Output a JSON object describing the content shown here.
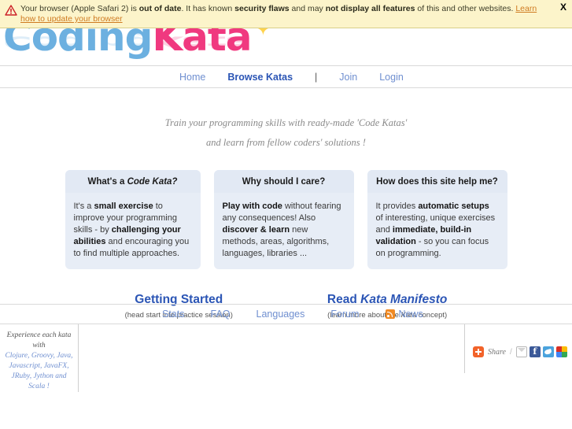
{
  "banner": {
    "warn_icon": "warning-triangle-icon",
    "text_1": "Your browser (Apple Safari 2) is ",
    "bold_1": "out of date",
    "text_2": ". It has known ",
    "bold_2": "security flaws",
    "text_3": " and may ",
    "bold_3": "not display all features",
    "text_4": " of this and other websites. ",
    "link": "Learn how to update your browser",
    "close_label": "X",
    "bg_color": "#fcf4ca",
    "link_color": "#cf7a20"
  },
  "logo": {
    "part1": "Coding",
    "part2": "Kata",
    "star": "✦",
    "color1": "#6cb0e0",
    "color2": "#f0397f",
    "star_color": "#ffd34d"
  },
  "nav": {
    "items": [
      {
        "label": "Home",
        "active": false
      },
      {
        "label": "Browse Katas",
        "active": true
      },
      {
        "label": "Join",
        "active": false
      },
      {
        "label": "Login",
        "active": false
      }
    ],
    "separator": "|",
    "link_color": "#6f8fd0",
    "active_color": "#2b55b5"
  },
  "tagline": {
    "line1": "Train your programming skills with ready-made 'Code Katas'",
    "line2": "and learn from fellow coders' solutions !"
  },
  "boxes": [
    {
      "title_plain": "What's a ",
      "title_italic": "Code Kata?",
      "body": [
        {
          "t": "It's a ",
          "b": false
        },
        {
          "t": "small exercise",
          "b": true
        },
        {
          "t": " to improve your programming skills - by ",
          "b": false
        },
        {
          "t": "challenging your abilities",
          "b": true
        },
        {
          "t": " and encouraging you to find multiple approaches.",
          "b": false
        }
      ]
    },
    {
      "title_plain": "Why should I care?",
      "title_italic": "",
      "body": [
        {
          "t": "Play with code",
          "b": true
        },
        {
          "t": " without fearing any consequences! Also ",
          "b": false
        },
        {
          "t": "discover & learn",
          "b": true
        },
        {
          "t": " new methods, areas, algorithms, languages, libraries ...",
          "b": false
        }
      ]
    },
    {
      "title_plain": "How does this site help me?",
      "title_italic": "",
      "body": [
        {
          "t": "It provides ",
          "b": false
        },
        {
          "t": "automatic setups",
          "b": true
        },
        {
          "t": " of interesting, unique exercises and ",
          "b": false
        },
        {
          "t": "immediate, build-in validation",
          "b": true
        },
        {
          "t": " - so you can focus on programming.",
          "b": false
        }
      ]
    }
  ],
  "cta": [
    {
      "link_plain": "Getting Started",
      "link_italic": "",
      "sub_plain": "(head start into practice session)",
      "sub_italic": "",
      "sub_tail": ""
    },
    {
      "link_plain": "Read ",
      "link_italic": "Kata Manifesto",
      "sub_plain": "(learn more about the ",
      "sub_italic": "Kata",
      "sub_tail": " concept)"
    }
  ],
  "footer_nav": {
    "items": [
      "Stats",
      "FAQ",
      "Languages",
      "Forum"
    ],
    "news_label": "News",
    "rss_icon": "rss-icon",
    "rss_color": "#f08a24"
  },
  "footer": {
    "langs_intro": "Experience each kata with",
    "langs_line2": "Clojure, Groovy, Java,",
    "langs_line3": "Javascript, JavaFX,",
    "langs_line4": "JRuby, Jython and Scala !",
    "share": {
      "label": "Share",
      "slash": "/",
      "plus_icon": "addthis-plus-icon",
      "mail_icon": "email-share-icon",
      "facebook_icon": "facebook-share-icon",
      "facebook_glyph": "f",
      "twitter_icon": "twitter-share-icon",
      "google_icon": "google-share-icon"
    }
  }
}
